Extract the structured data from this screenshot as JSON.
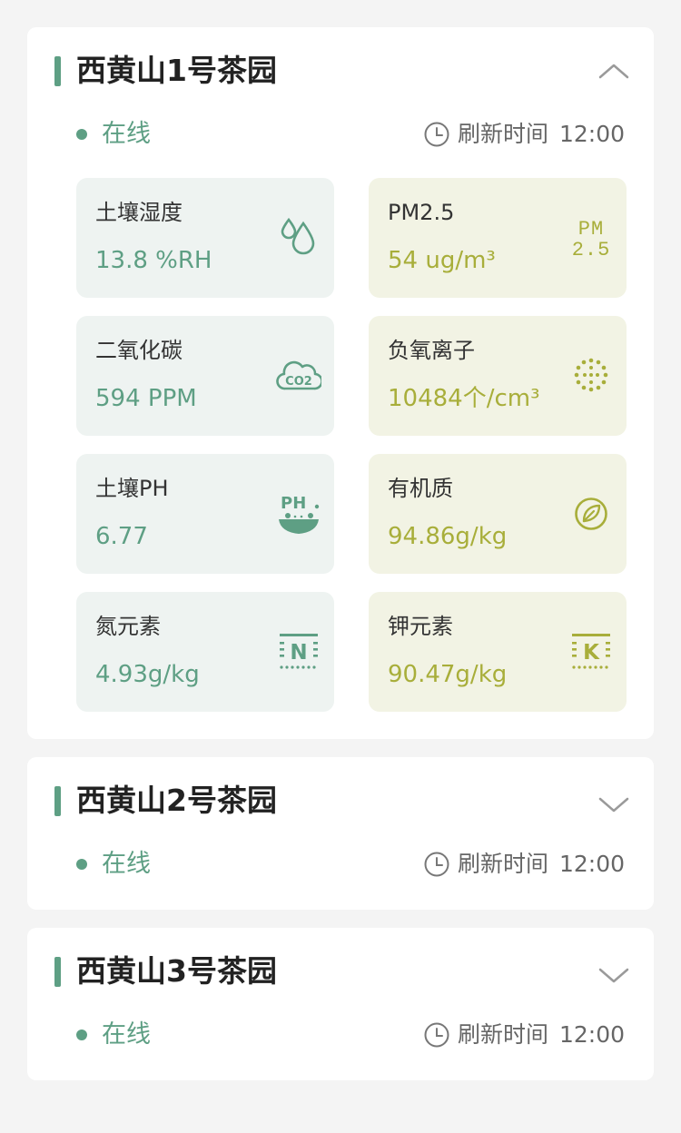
{
  "colors": {
    "green": "#5e9f84",
    "olive": "#a8ae3a",
    "page_bg": "#f4f4f4"
  },
  "gardens": [
    {
      "name": "西黄山1号茶园",
      "status": "在线",
      "refresh_label": "刷新时间",
      "refresh_time": "12:00",
      "expanded": true,
      "toggle_icon": "chevron-up-icon",
      "metrics": [
        {
          "label": "土壤湿度",
          "value": "13.8 %RH",
          "icon": "water-drop-icon",
          "tone": "green"
        },
        {
          "label": "PM2.5",
          "value": "54 ug/m³",
          "icon": "pm25-icon",
          "icon_text": [
            "PM",
            "2.5"
          ],
          "tone": "olive"
        },
        {
          "label": "二氧化碳",
          "value": "594 PPM",
          "icon": "co2-cloud-icon",
          "icon_text": [
            "CO2"
          ],
          "tone": "green"
        },
        {
          "label": "负氧离子",
          "value": "10484个/cm³",
          "icon": "ion-dots-icon",
          "tone": "olive"
        },
        {
          "label": "土壤PH",
          "value": "6.77",
          "icon": "ph-bowl-icon",
          "icon_text": [
            "PH"
          ],
          "tone": "green"
        },
        {
          "label": "有机质",
          "value": "94.86g/kg",
          "icon": "leaf-circle-icon",
          "tone": "olive"
        },
        {
          "label": "氮元素",
          "value": "4.93g/kg",
          "icon": "nitrogen-icon",
          "icon_text": [
            "N"
          ],
          "tone": "green"
        },
        {
          "label": "钾元素",
          "value": "90.47g/kg",
          "icon": "potassium-icon",
          "icon_text": [
            "K"
          ],
          "tone": "olive"
        }
      ]
    },
    {
      "name": "西黄山2号茶园",
      "status": "在线",
      "refresh_label": "刷新时间",
      "refresh_time": "12:00",
      "expanded": false,
      "toggle_icon": "chevron-down-icon"
    },
    {
      "name": "西黄山3号茶园",
      "status": "在线",
      "refresh_label": "刷新时间",
      "refresh_time": "12:00",
      "expanded": false,
      "toggle_icon": "chevron-down-icon"
    }
  ]
}
